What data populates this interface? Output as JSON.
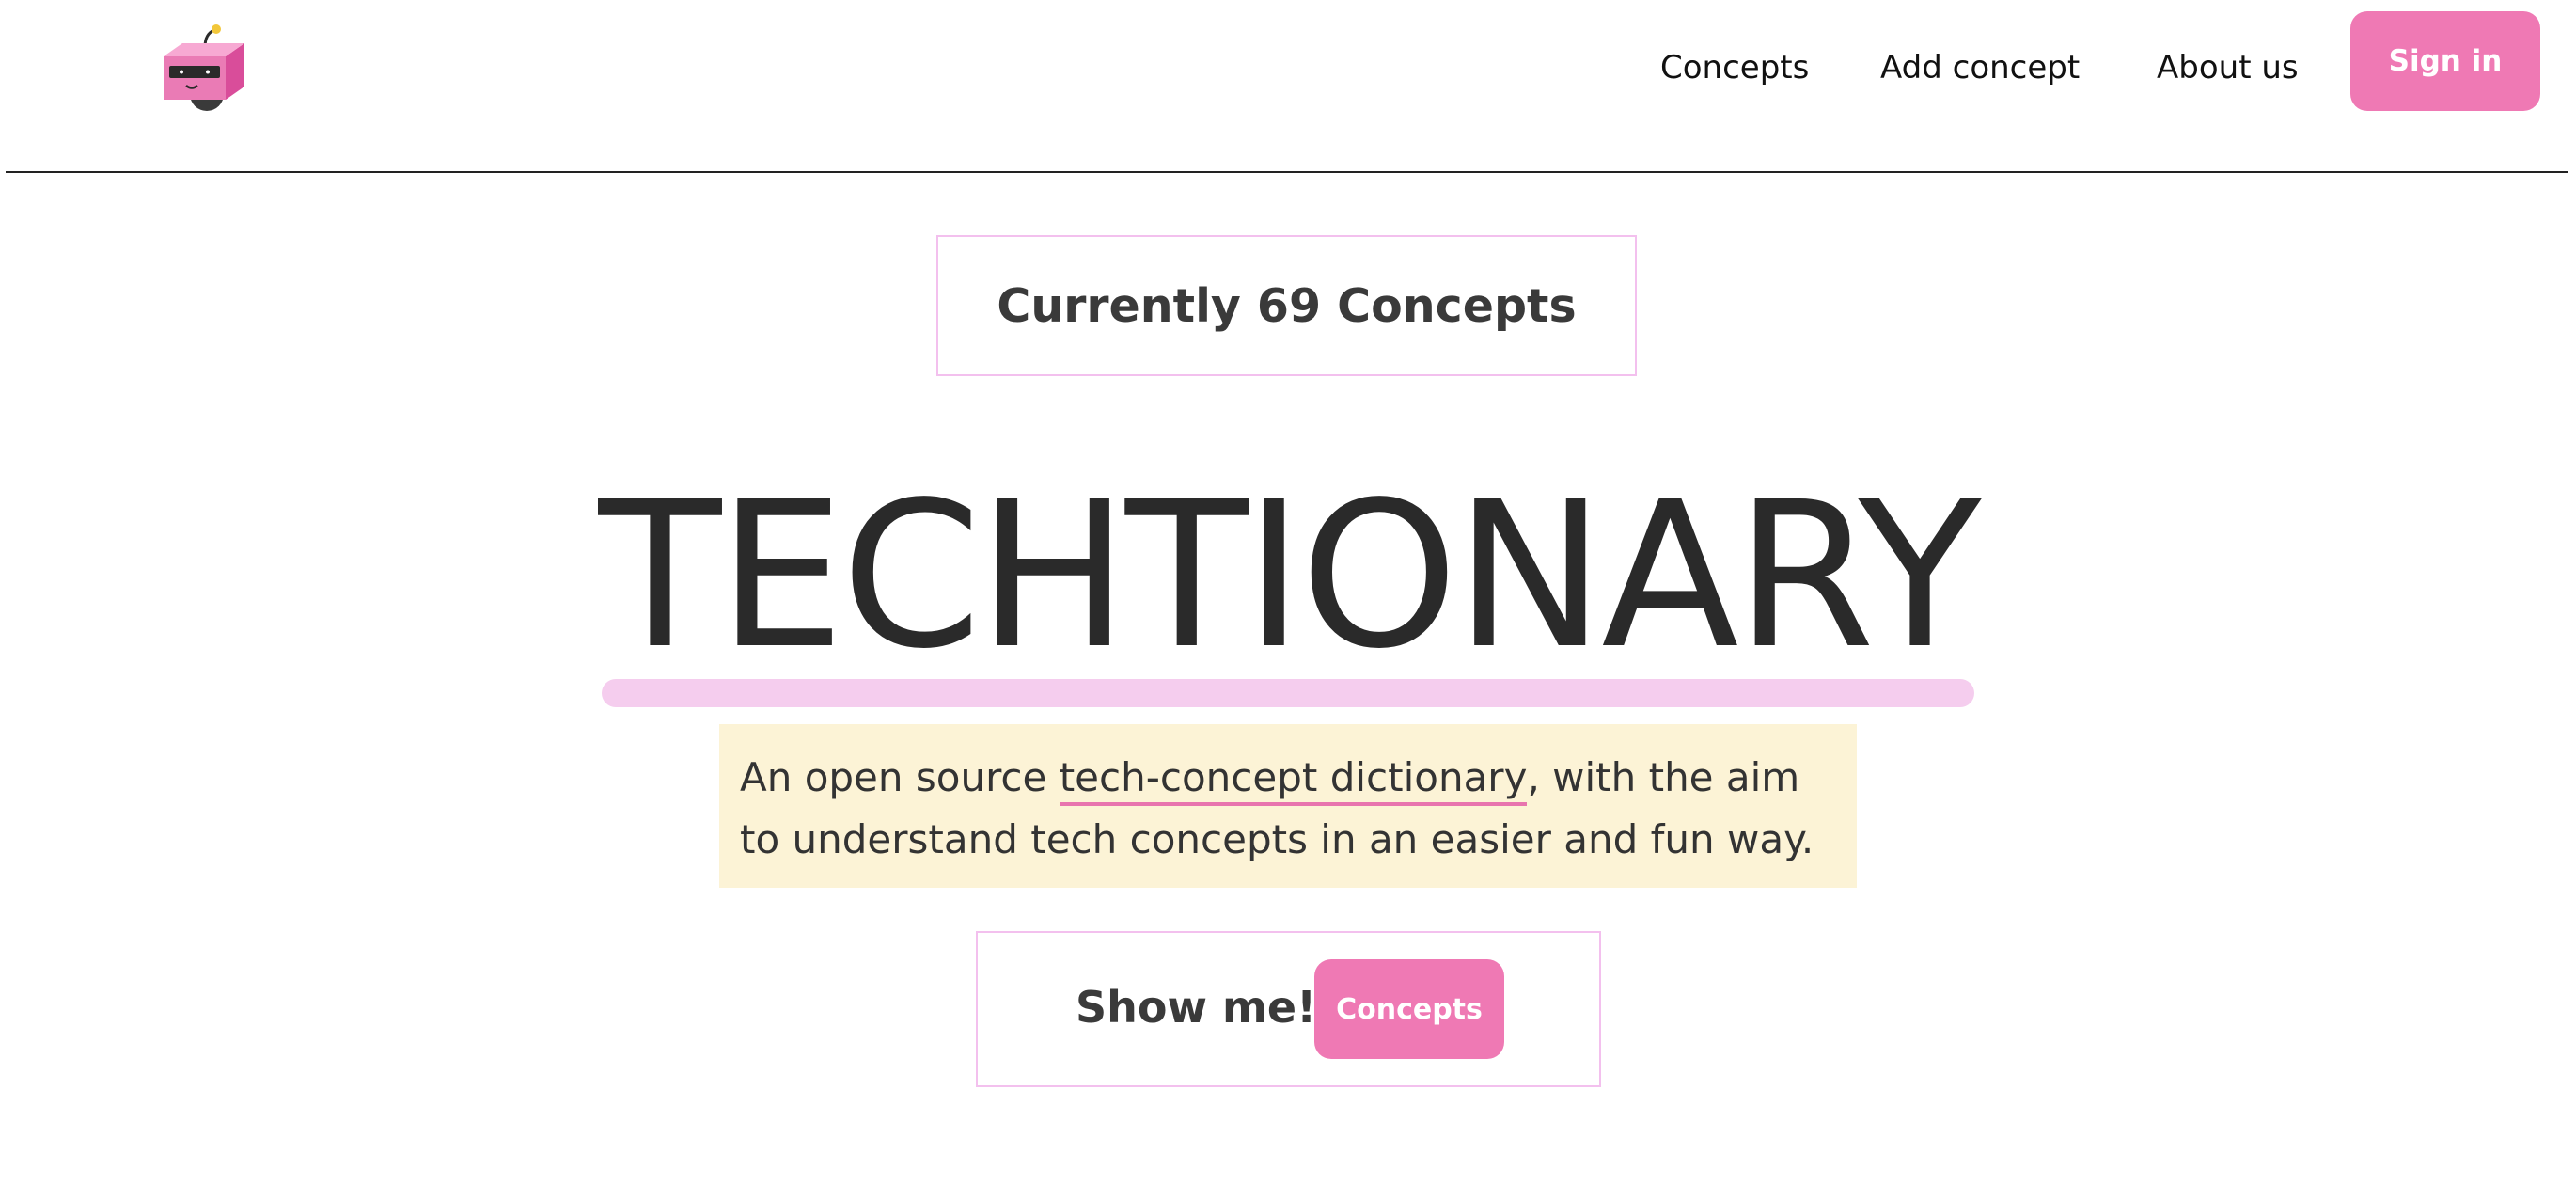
{
  "header": {
    "logo_icon": "robot-logo-icon",
    "nav": {
      "concepts": "Concepts",
      "add_concept": "Add concept",
      "about_us": "About us"
    },
    "sign_in": "Sign in"
  },
  "main": {
    "counter": {
      "prefix": "Currently",
      "count": "69",
      "suffix": "Concepts"
    },
    "title": "TECHTIONARY",
    "tagline": {
      "before": "An open source ",
      "highlight": "tech-concept dictionary",
      "after": ", with the aim to understand tech concepts in an easier and fun way."
    },
    "show_me": {
      "label": "Show me!",
      "button": "Concepts"
    }
  },
  "colors": {
    "accent_pink": "#ef79b4",
    "underline_pink": "#f5cdee",
    "box_border": "#f3c0ee",
    "tagline_bg": "#fcf3d6"
  }
}
